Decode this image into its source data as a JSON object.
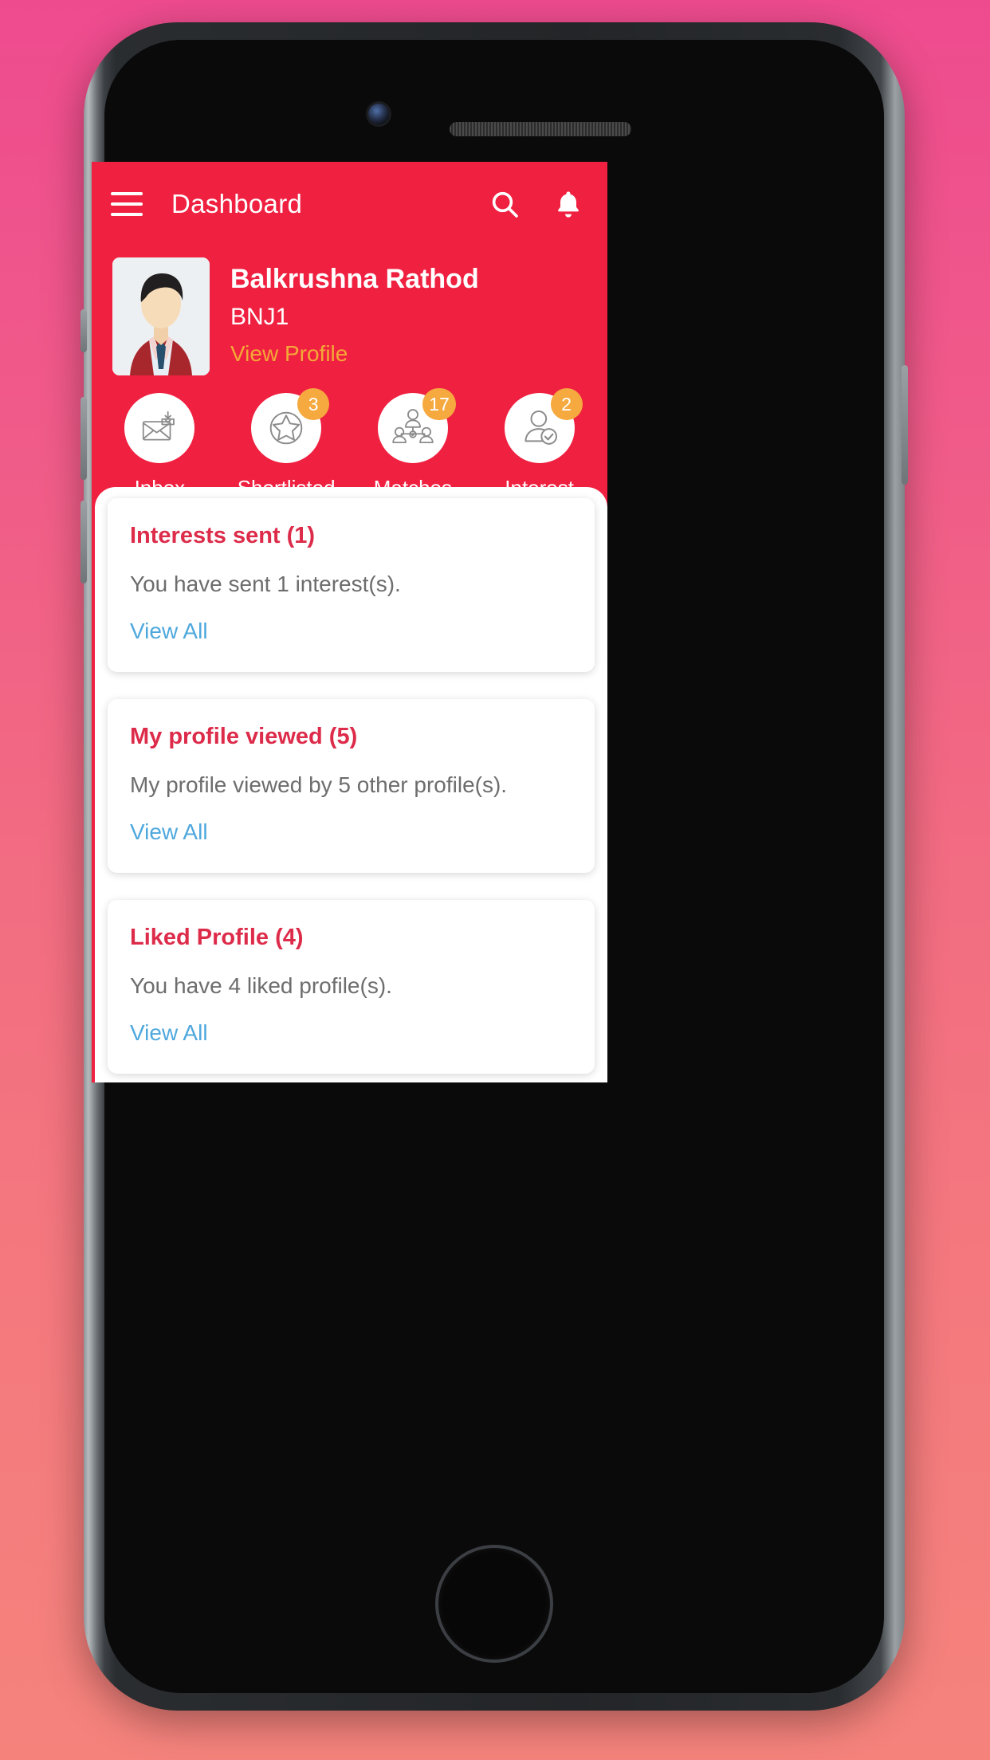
{
  "app": {
    "brand_red": "#F02040",
    "accent_orange": "#F5A93F",
    "link_blue": "#4FA8DD",
    "title_red": "#DD2B4A",
    "gold": "#F4A838"
  },
  "topbar": {
    "menu_label": "Menu",
    "title": "Dashboard",
    "search_label": "Search",
    "notifications_label": "Notifications"
  },
  "profile": {
    "name": "Balkrushna Rathod",
    "id": "BNJ1",
    "view_profile_label": "View Profile"
  },
  "quick_actions": [
    {
      "label": "Inbox",
      "badge": "",
      "icon": "envelope-icon"
    },
    {
      "label": "Shortlisted",
      "badge": "3",
      "icon": "star-circle-icon"
    },
    {
      "label": "Matches",
      "badge": "17",
      "icon": "people-group-icon"
    },
    {
      "label": "Interest",
      "badge": "2",
      "icon": "person-check-icon"
    }
  ],
  "cards": [
    {
      "title": "Interests sent (1)",
      "body": "You have sent 1 interest(s).",
      "link": "View All"
    },
    {
      "title": "My profile viewed (5)",
      "body": "My profile viewed by 5 other profile(s).",
      "link": "View All"
    },
    {
      "title": "Liked Profile (4)",
      "body": "You have 4 liked profile(s).",
      "link": "View All"
    }
  ]
}
